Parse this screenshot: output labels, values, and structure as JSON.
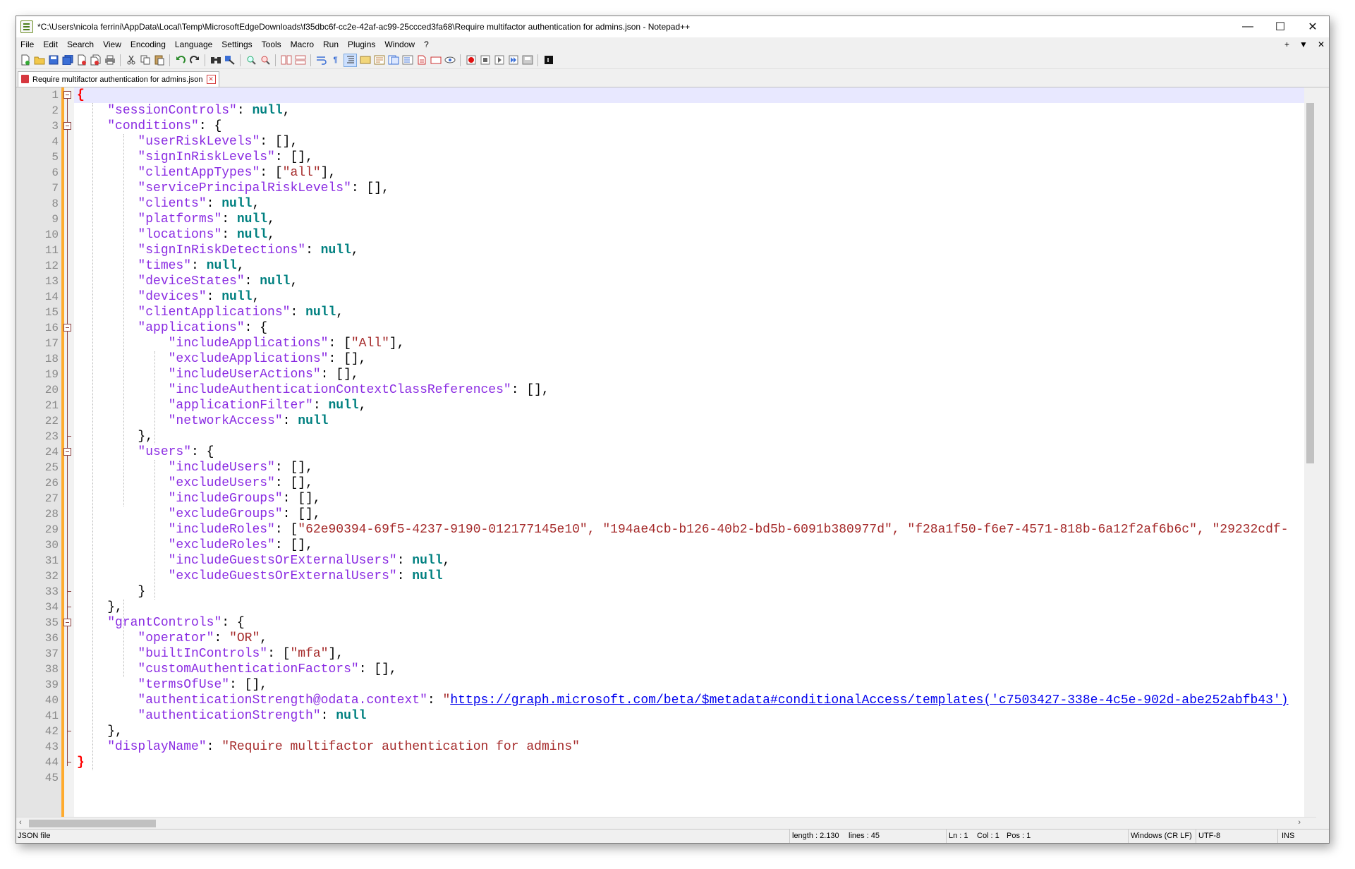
{
  "window": {
    "title": "*C:\\Users\\nicola ferrini\\AppData\\Local\\Temp\\MicrosoftEdgeDownloads\\f35dbc6f-cc2e-42af-ac99-25ccced3fa68\\Require multifactor authentication for admins.json - Notepad++",
    "minimize": "—",
    "maximize": "☐",
    "close": "✕"
  },
  "menu": {
    "items": [
      "File",
      "Edit",
      "Search",
      "View",
      "Encoding",
      "Language",
      "Settings",
      "Tools",
      "Macro",
      "Run",
      "Plugins",
      "Window",
      "?"
    ],
    "right": [
      "+",
      "▼",
      "✕"
    ]
  },
  "tab": {
    "label": "Require multifactor authentication for admins.json"
  },
  "editor": {
    "line_numbers": [
      "1",
      "2",
      "3",
      "4",
      "5",
      "6",
      "7",
      "8",
      "9",
      "10",
      "11",
      "12",
      "13",
      "14",
      "15",
      "16",
      "17",
      "18",
      "19",
      "20",
      "21",
      "22",
      "23",
      "24",
      "25",
      "26",
      "27",
      "28",
      "29",
      "30",
      "31",
      "32",
      "33",
      "34",
      "35",
      "36",
      "37",
      "38",
      "39",
      "40",
      "41",
      "42",
      "43",
      "44",
      "45"
    ],
    "keys": {
      "sessionControls": "\"sessionControls\"",
      "conditions": "\"conditions\"",
      "userRiskLevels": "\"userRiskLevels\"",
      "signInRiskLevels": "\"signInRiskLevels\"",
      "clientAppTypes": "\"clientAppTypes\"",
      "servicePrincipalRiskLevels": "\"servicePrincipalRiskLevels\"",
      "clients": "\"clients\"",
      "platforms": "\"platforms\"",
      "locations": "\"locations\"",
      "signInRiskDetections": "\"signInRiskDetections\"",
      "times": "\"times\"",
      "deviceStates": "\"deviceStates\"",
      "devices": "\"devices\"",
      "clientApplications": "\"clientApplications\"",
      "applications": "\"applications\"",
      "includeApplications": "\"includeApplications\"",
      "excludeApplications": "\"excludeApplications\"",
      "includeUserActions": "\"includeUserActions\"",
      "includeAuthenticationContextClassReferences": "\"includeAuthenticationContextClassReferences\"",
      "applicationFilter": "\"applicationFilter\"",
      "networkAccess": "\"networkAccess\"",
      "users": "\"users\"",
      "includeUsers": "\"includeUsers\"",
      "excludeUsers": "\"excludeUsers\"",
      "includeGroups": "\"includeGroups\"",
      "excludeGroups": "\"excludeGroups\"",
      "includeRoles": "\"includeRoles\"",
      "excludeRoles": "\"excludeRoles\"",
      "includeGuestsOrExternalUsers": "\"includeGuestsOrExternalUsers\"",
      "excludeGuestsOrExternalUsers": "\"excludeGuestsOrExternalUsers\"",
      "grantControls": "\"grantControls\"",
      "operator": "\"operator\"",
      "builtInControls": "\"builtInControls\"",
      "customAuthenticationFactors": "\"customAuthenticationFactors\"",
      "termsOfUse": "\"termsOfUse\"",
      "authenticationStrengthContext": "\"authenticationStrength@odata.context\"",
      "authenticationStrength": "\"authenticationStrength\"",
      "displayName": "\"displayName\""
    },
    "values": {
      "null": "null",
      "all_lower": "\"all\"",
      "all_upper": "\"All\"",
      "include_roles": "\"62e90394-69f5-4237-9190-012177145e10\", \"194ae4cb-b126-40b2-bd5b-6091b380977d\", \"f28a1f50-f6e7-4571-818b-6a12f2af6b6c\", \"29232cdf-",
      "operator": "\"OR\"",
      "mfa": "\"mfa\"",
      "auth_context_url": "https://graph.microsoft.com/beta/$metadata#conditionalAccess/templates('c7503427-338e-4c5e-902d-abe252abfb43')",
      "display_name": "\"Require multifactor authentication for admins\""
    }
  },
  "status": {
    "file_type": "JSON file",
    "length": "length : 2.130",
    "lines": "lines : 45",
    "ln": "Ln : 1",
    "col": "Col : 1",
    "pos": "Pos : 1",
    "eol": "Windows (CR LF)",
    "encoding": "UTF-8",
    "mode": "INS"
  },
  "colors": {
    "key": "#8a2be2",
    "string": "#a52a2a",
    "null": "#008080",
    "brace": "#ff0000",
    "change_bar": "#ffab2e",
    "current_line": "#e8e8ff"
  }
}
